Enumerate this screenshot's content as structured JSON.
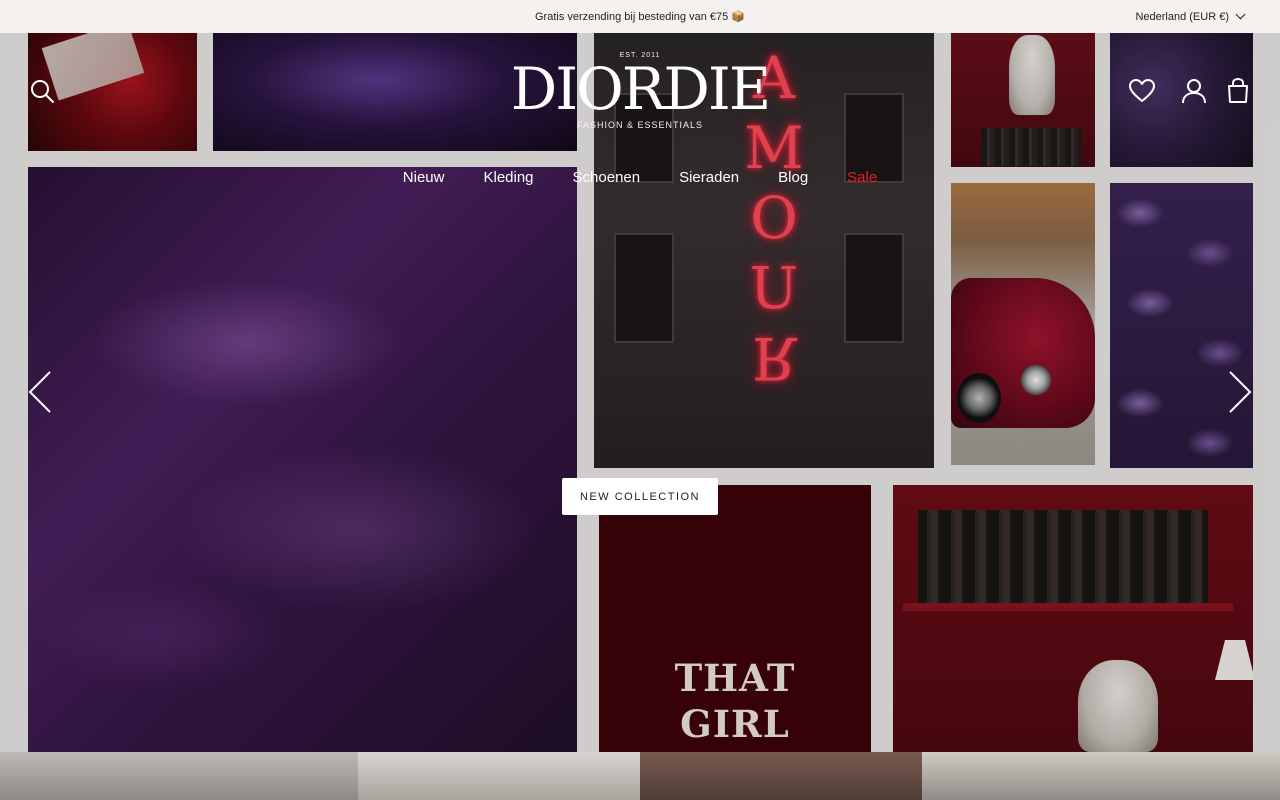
{
  "announcement": {
    "text": "Gratis verzending bij besteding van €75 📦"
  },
  "country_selector": {
    "label": "Nederland (EUR €)"
  },
  "brand": {
    "est": "EST. 2011",
    "name": "DIORDIE",
    "tagline": "FASHION & ESSENTIALS"
  },
  "header_icons": [
    "search-icon",
    "heart-icon",
    "account-icon",
    "cart-icon"
  ],
  "nav": {
    "items": [
      {
        "label": "Nieuw"
      },
      {
        "label": "Kleding"
      },
      {
        "label": "Schoenen"
      },
      {
        "label": "Sieraden"
      },
      {
        "label": "Blog"
      },
      {
        "label": "Sale"
      }
    ]
  },
  "hero": {
    "cta_label": "NEW COLLECTION",
    "neon_text": "AMOUR",
    "poster_line1": "THAT",
    "poster_line2": "GIRL"
  },
  "colors": {
    "sale": "#e0202b",
    "announcement_bg": "#f5f1ef",
    "white": "#ffffff"
  }
}
